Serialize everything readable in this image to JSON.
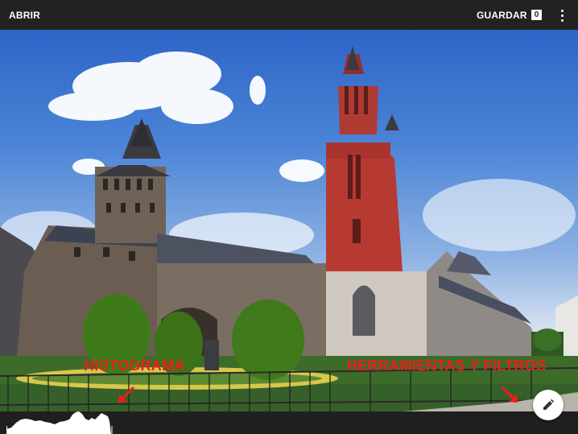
{
  "toolbar": {
    "open_label": "ABRIR",
    "save_label": "GUARDAR",
    "save_count": "0",
    "menu_icon": "more-vert-icon",
    "background_color": "#222222",
    "text_color": "#ffffff"
  },
  "annotations": {
    "histogram_label": "HISTOGRAMA",
    "tools_label": "HERRAMIENTAS Y FILTROS",
    "color": "#ee1c1c",
    "arrow_icon": "arrow-down-icon"
  },
  "fab": {
    "icon": "pencil-icon",
    "background_color": "#ffffff"
  },
  "histogram": {
    "icon": "histogram-graph",
    "color": "#ffffff"
  },
  "photo": {
    "subject": "churches-under-blue-sky"
  }
}
